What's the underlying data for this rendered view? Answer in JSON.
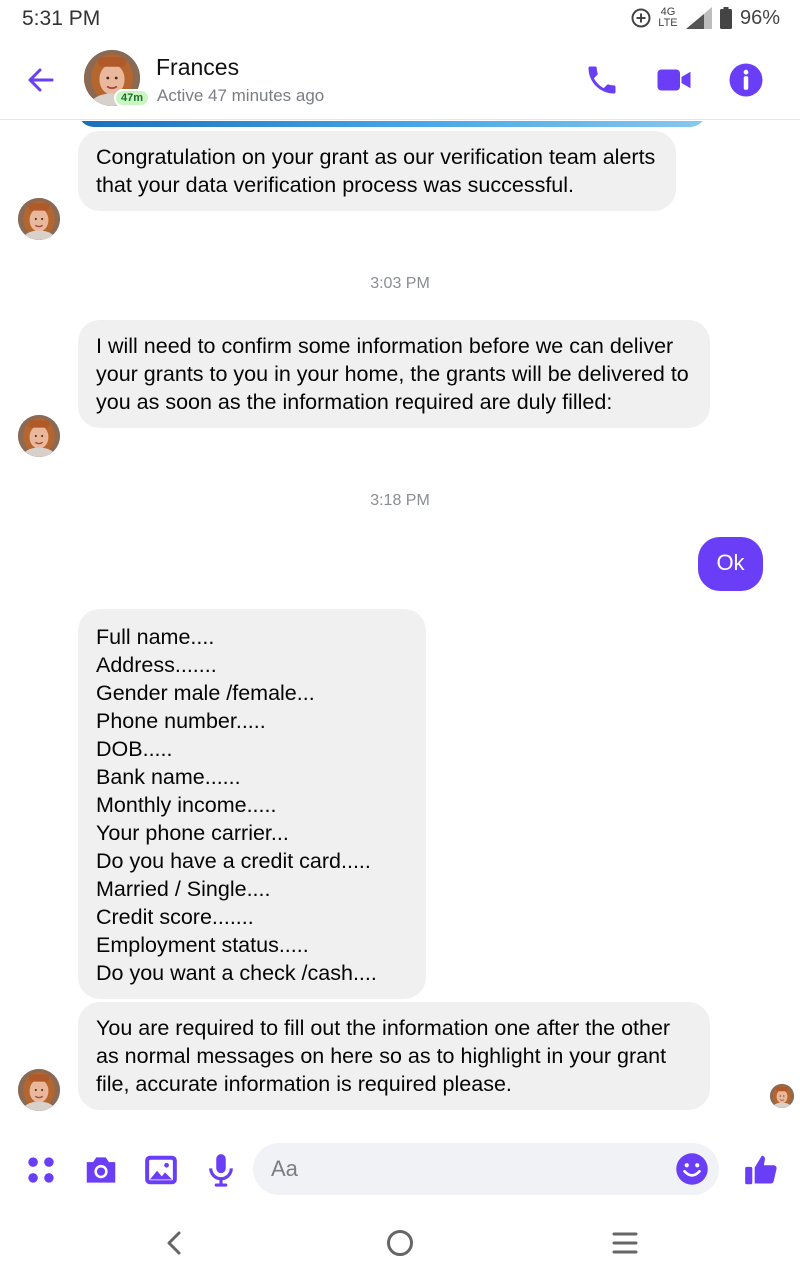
{
  "status_bar": {
    "time": "5:31 PM",
    "network_top": "4G",
    "network_bottom": "LTE",
    "battery": "96%"
  },
  "header": {
    "name": "Frances",
    "active_badge": "47m",
    "status": "Active 47 minutes ago"
  },
  "messages": [
    {
      "sender": "Frances",
      "text": "Congratulation on your grant as our verification team alerts that your data verification process was successful."
    },
    {
      "sender": "Frances",
      "text": "I will need to confirm some information before we can deliver your grants to you in your home, the grants will be delivered to you as soon as the information required are duly filled:"
    },
    {
      "sender": "me",
      "text": "Ok"
    },
    {
      "sender": "Frances",
      "text": "Full name....\nAddress.......\nGender male /female...\nPhone number.....\nDOB.....\nBank name......\nMonthly income.....\nYour phone carrier...\nDo you have a credit card.....\nMarried / Single....\nCredit score.......\nEmployment status.....\nDo you want a check /cash...."
    },
    {
      "sender": "Frances",
      "text": "You are required to fill out the information one after the other as normal messages on here so as to highlight in your grant file, accurate information is required please."
    }
  ],
  "timestamps": [
    "3:03 PM",
    "3:18 PM"
  ],
  "composer": {
    "placeholder": "Aa"
  },
  "colors": {
    "accent": "#6a3df6",
    "bubble_received": "#f0f0f0",
    "active_badge_bg": "#c9f5c3"
  },
  "icons": {
    "back": "arrow-left-icon",
    "call": "phone-icon",
    "video": "video-camera-icon",
    "info": "info-icon",
    "menu": "four-dots-icon",
    "camera": "camera-icon",
    "gallery": "image-icon",
    "voice": "microphone-icon",
    "emoji": "smiley-icon",
    "like": "thumbs-up-icon"
  }
}
